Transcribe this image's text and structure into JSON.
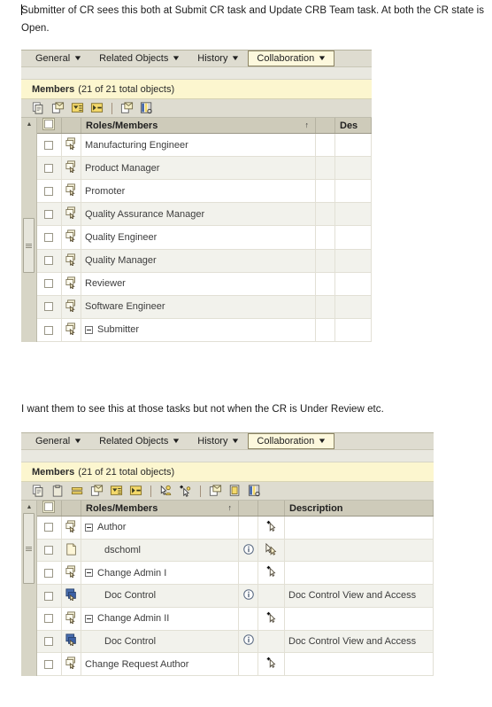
{
  "notes": {
    "top": "Submitter of CR sees this both at Submit CR task and Update CRB Team task. At both the CR state is Open.",
    "middle": "I want them to see this at those tasks but not when the CR is Under Review etc."
  },
  "tabs": [
    {
      "label": "General",
      "selected": false
    },
    {
      "label": "Related Objects",
      "selected": false
    },
    {
      "label": "History",
      "selected": false
    },
    {
      "label": "Collaboration",
      "selected": true
    }
  ],
  "panel_one": {
    "title_bold": "Members",
    "title_rest": "(21 of 21 total objects)",
    "toolbar_icons": [
      "copy-icon",
      "open-envelope-icon",
      "filter-dropdown-icon",
      "run-action-icon",
      "separator",
      "mail-icon",
      "report-columns-icon"
    ],
    "columns": [
      {
        "key": "select",
        "label": ""
      },
      {
        "key": "icon",
        "label": ""
      },
      {
        "key": "name",
        "label": "Roles/Members",
        "sort": "↑"
      },
      {
        "key": "spacer",
        "label": ""
      },
      {
        "key": "desc",
        "label": "Des"
      }
    ],
    "rows": [
      {
        "name": "Manufacturing Engineer",
        "icon": "role-icon",
        "expander": false,
        "indent": 0
      },
      {
        "name": "Product Manager",
        "icon": "role-icon",
        "expander": false,
        "indent": 0
      },
      {
        "name": "Promoter",
        "icon": "role-icon",
        "expander": false,
        "indent": 0
      },
      {
        "name": "Quality Assurance Manager",
        "icon": "role-icon",
        "expander": false,
        "indent": 0
      },
      {
        "name": "Quality Engineer",
        "icon": "role-icon",
        "expander": false,
        "indent": 0
      },
      {
        "name": "Quality Manager",
        "icon": "role-icon",
        "expander": false,
        "indent": 0
      },
      {
        "name": "Reviewer",
        "icon": "role-icon",
        "expander": false,
        "indent": 0
      },
      {
        "name": "Software Engineer",
        "icon": "role-icon",
        "expander": false,
        "indent": 0
      },
      {
        "name": "Submitter",
        "icon": "role-icon",
        "expander": true,
        "indent": 0
      }
    ]
  },
  "panel_two": {
    "title_bold": "Members",
    "title_rest": "(21 of 21 total objects)",
    "toolbar_icons": [
      "copy-icon",
      "paste-icon",
      "remove-row-icon",
      "open-envelope-icon",
      "filter-dropdown-icon",
      "run-action-icon",
      "separator",
      "add-person-cursor-icon",
      "add-member-icon",
      "separator",
      "mail-icon",
      "properties-icon",
      "report-columns-icon"
    ],
    "columns": [
      {
        "key": "select",
        "label": ""
      },
      {
        "key": "icon",
        "label": ""
      },
      {
        "key": "name",
        "label": "Roles/Members",
        "sort": "↑"
      },
      {
        "key": "info",
        "label": ""
      },
      {
        "key": "action",
        "label": ""
      },
      {
        "key": "desc",
        "label": "Description"
      }
    ],
    "rows": [
      {
        "name": "Author",
        "icon": "role-icon",
        "expander": true,
        "indent": 0,
        "info": false,
        "action": "add-member-icon",
        "desc": ""
      },
      {
        "name": "dschoml",
        "icon": "person-icon",
        "expander": false,
        "indent": 1,
        "info": true,
        "action": "person-cursor-icon",
        "desc": ""
      },
      {
        "name": "Change Admin I",
        "icon": "role-icon",
        "expander": true,
        "indent": 0,
        "info": false,
        "action": "add-member-icon",
        "desc": ""
      },
      {
        "name": "Doc Control",
        "icon": "group-icon",
        "expander": false,
        "indent": 1,
        "info": true,
        "action": "",
        "desc": "Doc Control View and Access"
      },
      {
        "name": "Change Admin II",
        "icon": "role-icon",
        "expander": true,
        "indent": 0,
        "info": false,
        "action": "add-member-icon",
        "desc": ""
      },
      {
        "name": "Doc Control",
        "icon": "group-icon",
        "expander": false,
        "indent": 1,
        "info": true,
        "action": "",
        "desc": "Doc Control View and Access"
      },
      {
        "name": "Change Request Author",
        "icon": "role-icon",
        "expander": false,
        "indent": 0,
        "info": false,
        "action": "add-member-icon",
        "desc": ""
      }
    ]
  },
  "colors": {
    "tab_bar": "#dedcd0",
    "tab_selected_bg": "#fdf8dd",
    "tab_selected_border": "#8c8464",
    "title_bar": "#fcf6cf",
    "column_header": "#cecbba",
    "row_alt": "#f2f2ec",
    "text": "#333333"
  }
}
